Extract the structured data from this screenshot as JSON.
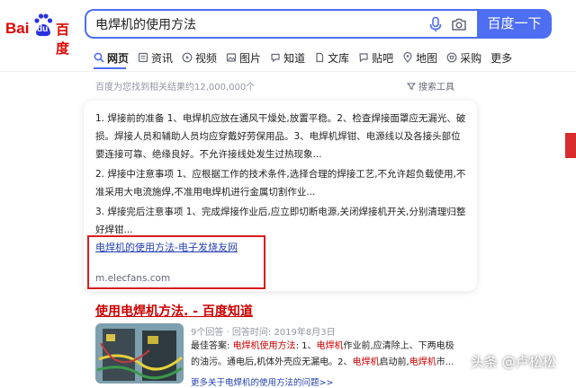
{
  "logo": {
    "bai": "Bai",
    "du": "du",
    "cn": "百度"
  },
  "search": {
    "query": "电焊机的使用方法",
    "button": "百度一下"
  },
  "tabs": [
    {
      "label": "网页",
      "icon": "search-icon"
    },
    {
      "label": "资讯",
      "icon": "news-icon"
    },
    {
      "label": "视频",
      "icon": "video-icon"
    },
    {
      "label": "图片",
      "icon": "image-icon"
    },
    {
      "label": "知道",
      "icon": "qa-icon"
    },
    {
      "label": "文库",
      "icon": "doc-icon"
    },
    {
      "label": "贴吧",
      "icon": "tieba-icon"
    },
    {
      "label": "地图",
      "icon": "map-icon"
    },
    {
      "label": "采购",
      "icon": "cart-icon"
    },
    {
      "label": "更多",
      "icon": ""
    }
  ],
  "result_count": "百度为您找到相关结果约12,000,000个",
  "tools": "搜索工具",
  "card": {
    "p1": "1. 焊接前的准备 1、电焊机应放在通风干燥处,放置平稳。2、检查焊接面罩应无漏光、破损。焊接人员和辅助人员均应穿戴好劳保用品。3、电焊机焊钳、电源线以及各接头部位要连接可靠、绝缘良好。不允许接线处发生过热现象...",
    "p2": "2. 焊接中注意事项 1、应根据工作的技术条件,选择合理的焊接工艺,不允许超负载使用,不准采用大电流施焊,不准用电焊机进行金属切割作业...",
    "p3": "3. 焊接完后注意事项 1、完成焊接作业后,应立即切断电源,关闭焊接机开关,分别清理归整好焊钳...",
    "link": "电焊机的使用方法-电子发烧友网",
    "url": "m.elecfans.com"
  },
  "result2": {
    "title": "使用电焊机方法. - 百度知道",
    "meta": "9个回答 · 回答时间: 2019年8月3日",
    "label": "最佳答案:",
    "hl1": "电焊机使用方法",
    "t1": ": 1、",
    "hl2": "电焊机",
    "t2": "作业前,应清除上、下两电极的油污。通电后,机体外壳应无漏电。2、",
    "hl3": "电焊机",
    "t3": "启动前,",
    "hl4": "电焊机",
    "t4": "市...",
    "more": "更多关于电焊机的使用方法的问题>>"
  },
  "watermark": "头条 @卢松松",
  "colors": {
    "brand_blue": "#4e6ef2",
    "baidu_red": "#e10602",
    "link_blue": "#2440b3",
    "highlight_red": "#cc0000"
  }
}
